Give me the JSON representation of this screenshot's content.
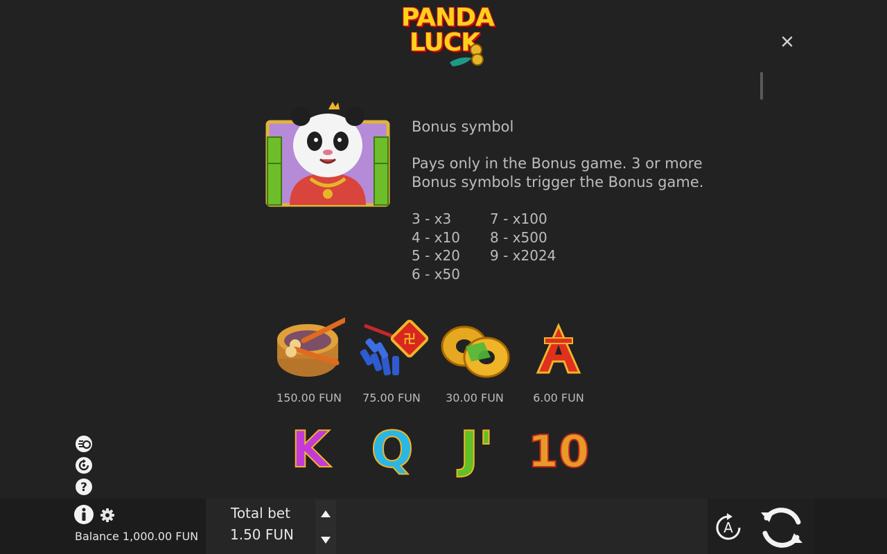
{
  "header": {
    "logo_line1": "PANDA",
    "logo_line2": "LUCK",
    "close_icon": "close-icon"
  },
  "bonus": {
    "title": "Bonus symbol",
    "description": "Pays only in the Bonus game. 3 or more Bonus symbols trigger the Bonus game.",
    "payouts_col1": [
      "3 - x3",
      "4 - x10",
      "5 - x20",
      "6 - x50"
    ],
    "payouts_col2": [
      "7 - x100",
      "8 - x500",
      "9 - x2024"
    ]
  },
  "symbols_row1": [
    {
      "icon": "drum-icon",
      "price": "150.00 FUN"
    },
    {
      "icon": "firecracker-icon",
      "price": "75.00 FUN"
    },
    {
      "icon": "gold-coins-icon",
      "price": "30.00 FUN"
    },
    {
      "icon": "letter-a-icon",
      "price": "6.00 FUN"
    }
  ],
  "symbols_row2": [
    {
      "icon": "letter-k-icon",
      "label": "K",
      "color": "#c43ad8"
    },
    {
      "icon": "letter-q-icon",
      "label": "Q",
      "color": "#2bb6e3"
    },
    {
      "icon": "letter-j-icon",
      "label": "J'",
      "color": "#5fc126"
    },
    {
      "icon": "number-10-icon",
      "label": "10",
      "color": "#e69a27"
    }
  ],
  "footer": {
    "balance": "Balance 1,000.00 FUN",
    "total_bet_label": "Total bet",
    "total_bet_value": "1.50 FUN",
    "auto_label": "A"
  },
  "colors": {
    "background": "#222222",
    "text": "#bdbdbd",
    "logo_yellow": "#ffd21a",
    "logo_red": "#c0151a"
  }
}
